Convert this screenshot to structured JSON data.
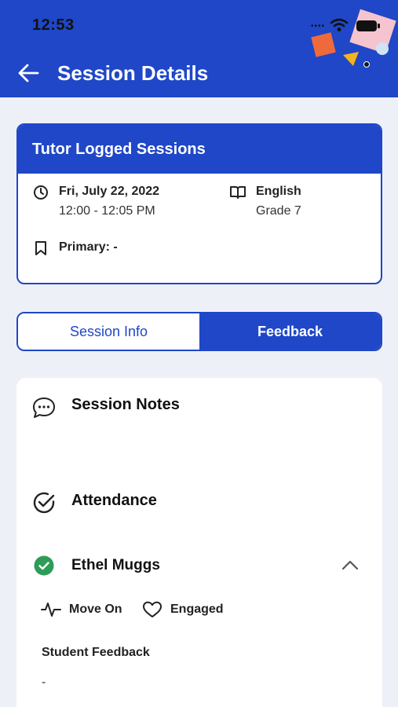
{
  "status_bar": {
    "time": "12:53"
  },
  "header": {
    "title": "Session Details"
  },
  "session_card": {
    "heading": "Tutor Logged Sessions",
    "date": "Fri, July 22, 2022",
    "time_range": "12:00 - 12:05 PM",
    "subject": "English",
    "grade": "Grade 7",
    "primary": "Primary: -"
  },
  "tabs": [
    {
      "label": "Session Info",
      "active": false
    },
    {
      "label": "Feedback",
      "active": true
    }
  ],
  "notes": {
    "title": "Session Notes"
  },
  "attendance": {
    "title": "Attendance",
    "student": {
      "name": "Ethel Muggs",
      "tags": [
        "Move On",
        "Engaged"
      ],
      "feedback_label": "Student Feedback",
      "feedback_value": "-"
    }
  },
  "colors": {
    "primary": "#1f47c7",
    "background": "#eef0f8",
    "success": "#2e9b57"
  },
  "icons": [
    "back-arrow-icon",
    "wifi-icon",
    "battery-icon",
    "clock-icon",
    "book-icon",
    "bookmark-icon",
    "chat-icon",
    "check-circle-icon",
    "success-check-icon",
    "chevron-up-icon",
    "pulse-icon",
    "heart-icon"
  ]
}
